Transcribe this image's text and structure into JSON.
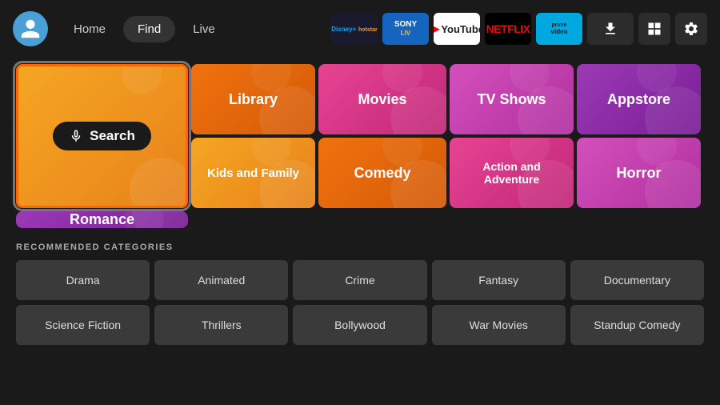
{
  "header": {
    "nav": [
      {
        "id": "home",
        "label": "Home",
        "active": false
      },
      {
        "id": "find",
        "label": "Find",
        "active": true
      },
      {
        "id": "live",
        "label": "Live",
        "active": false
      }
    ],
    "apps": [
      {
        "id": "disney",
        "label": "Disney+ Hotstar"
      },
      {
        "id": "sony",
        "label": "Sony LIV"
      },
      {
        "id": "youtube",
        "label": "YouTube"
      },
      {
        "id": "netflix",
        "label": "NETFLIX"
      },
      {
        "id": "prime",
        "label": "prime video"
      },
      {
        "id": "downloader",
        "label": "Downloader"
      }
    ]
  },
  "grid": {
    "items": [
      {
        "id": "search",
        "label": "Search",
        "type": "search"
      },
      {
        "id": "library",
        "label": "Library"
      },
      {
        "id": "movies",
        "label": "Movies"
      },
      {
        "id": "tvshows",
        "label": "TV Shows"
      },
      {
        "id": "appstore",
        "label": "Appstore"
      },
      {
        "id": "kids",
        "label": "Kids and Family"
      },
      {
        "id": "comedy",
        "label": "Comedy"
      },
      {
        "id": "action",
        "label": "Action and Adventure"
      },
      {
        "id": "horror",
        "label": "Horror"
      },
      {
        "id": "romance",
        "label": "Romance"
      }
    ]
  },
  "recommended": {
    "title": "RECOMMENDED CATEGORIES",
    "items": [
      {
        "id": "drama",
        "label": "Drama"
      },
      {
        "id": "animated",
        "label": "Animated"
      },
      {
        "id": "crime",
        "label": "Crime"
      },
      {
        "id": "fantasy",
        "label": "Fantasy"
      },
      {
        "id": "documentary",
        "label": "Documentary"
      },
      {
        "id": "scifi",
        "label": "Science Fiction"
      },
      {
        "id": "thrillers",
        "label": "Thrillers"
      },
      {
        "id": "bollywood",
        "label": "Bollywood"
      },
      {
        "id": "war",
        "label": "War Movies"
      },
      {
        "id": "standup",
        "label": "Standup Comedy"
      }
    ]
  }
}
